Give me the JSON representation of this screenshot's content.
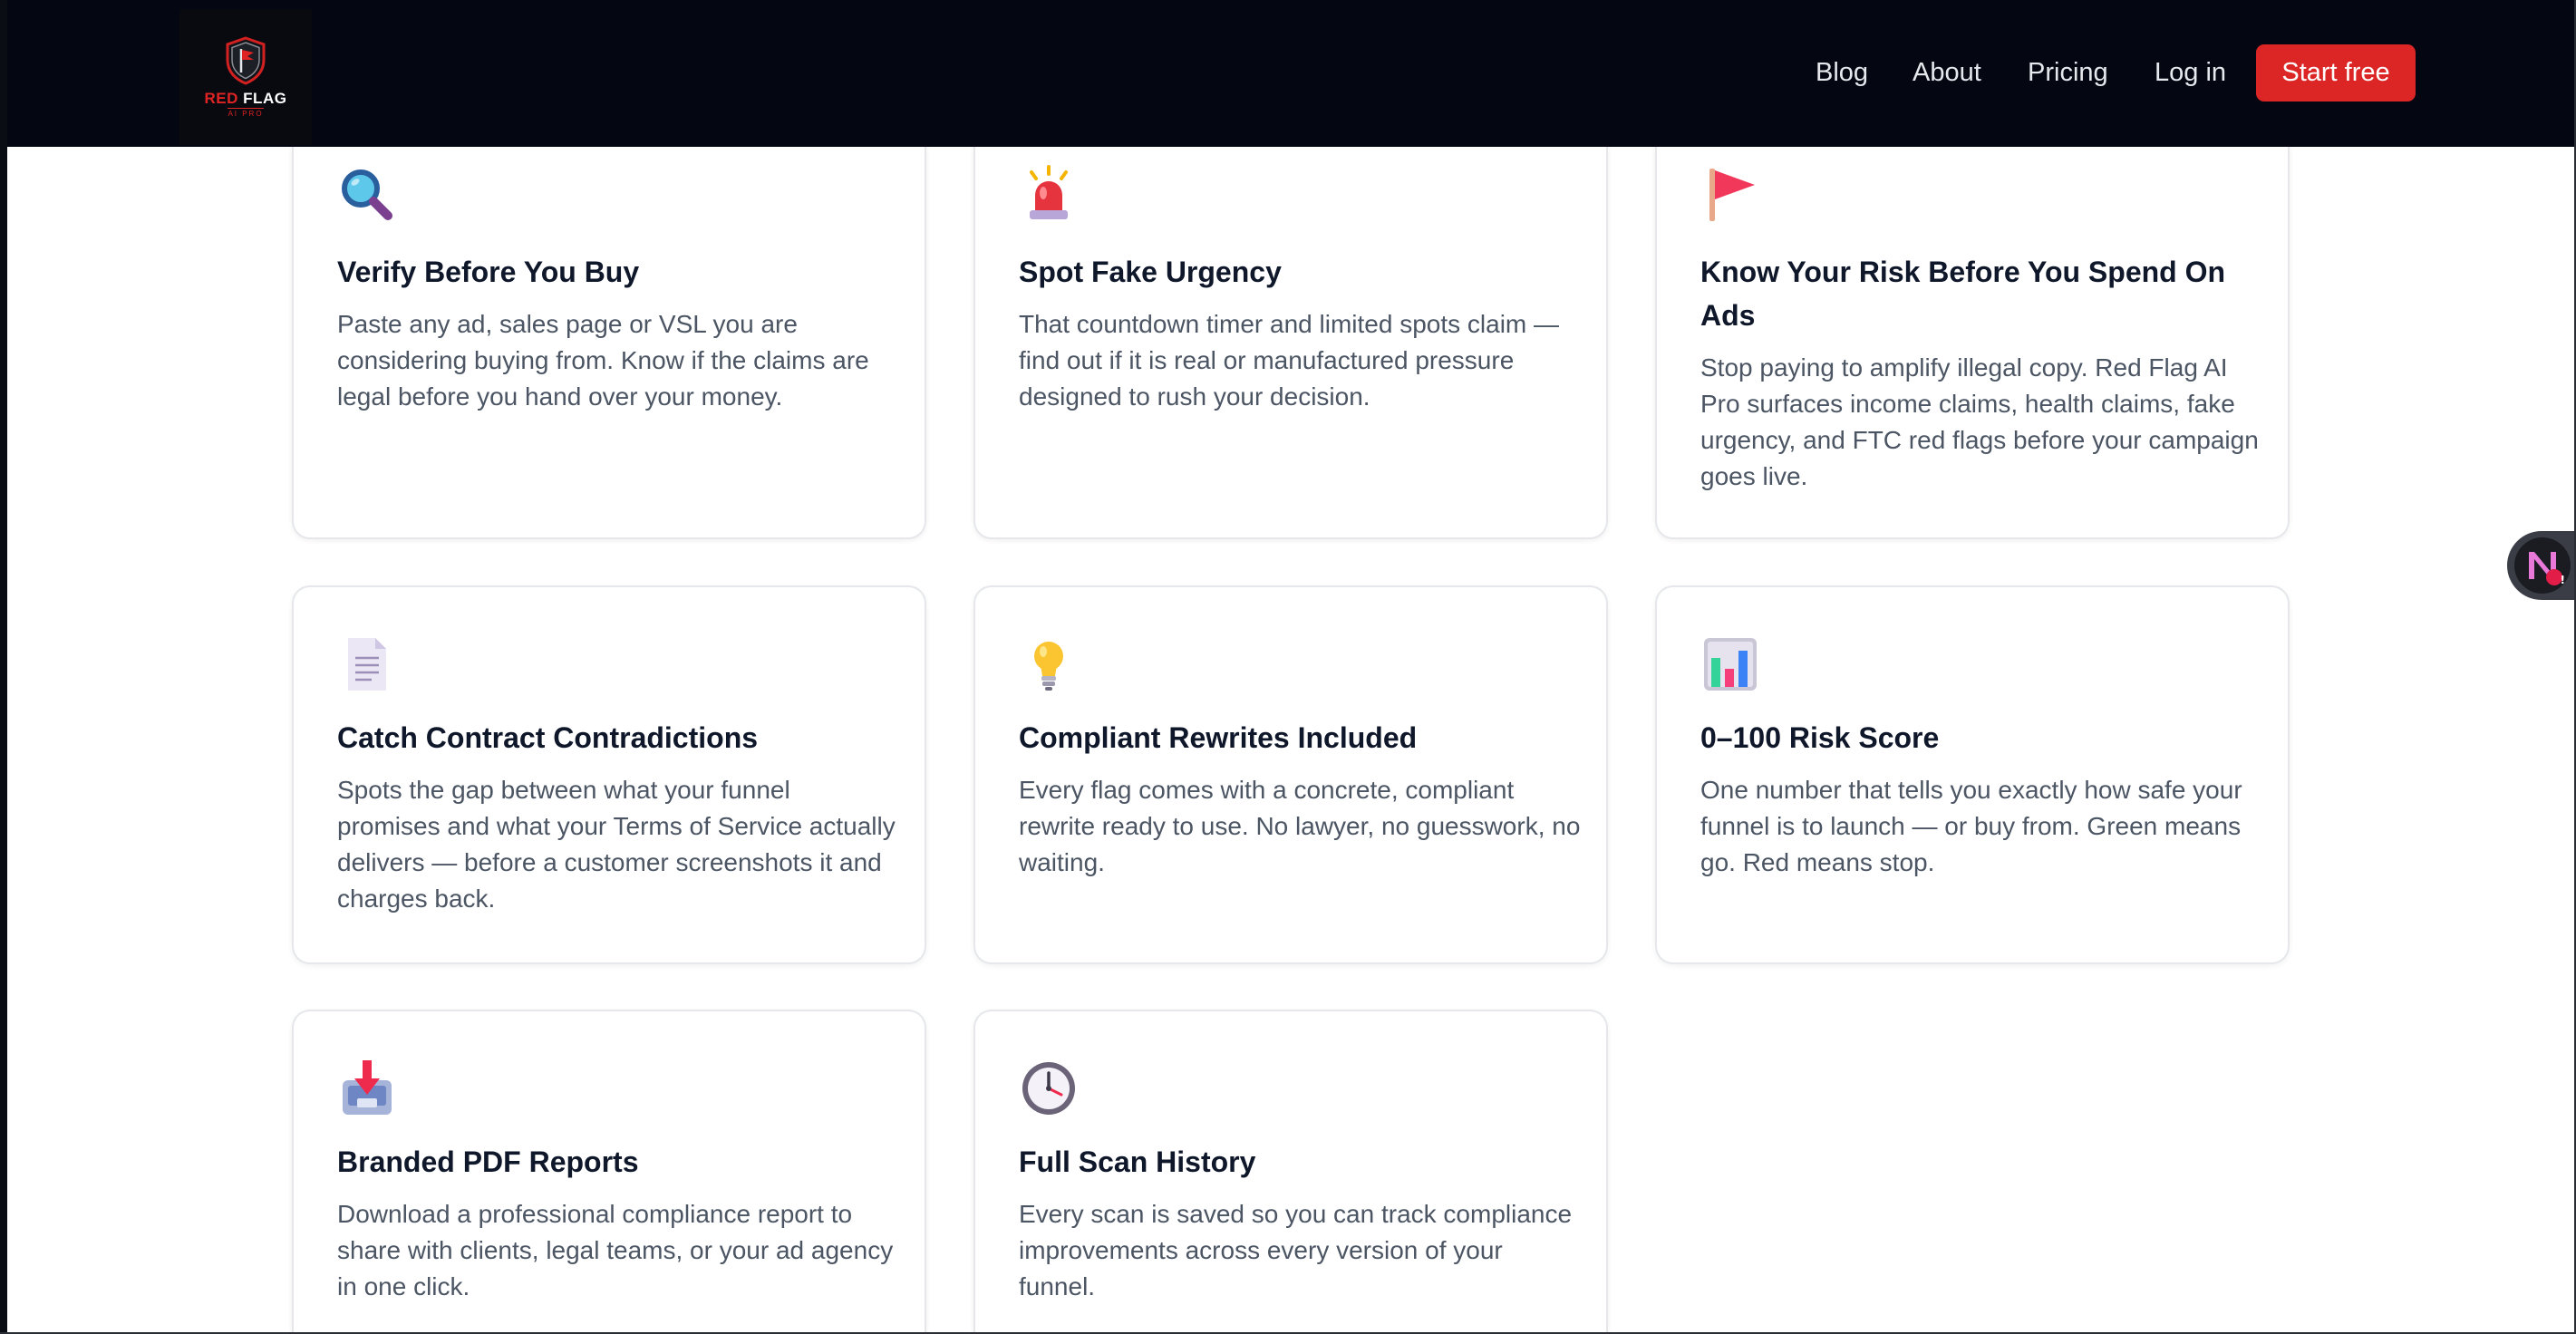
{
  "header": {
    "logo": {
      "line1_red": "RED",
      "line1_white": "FLAG",
      "line2": "AI PRO",
      "icon": "shield-flag-logo"
    },
    "nav": {
      "blog": "Blog",
      "about": "About",
      "pricing": "Pricing",
      "login": "Log in",
      "cta": "Start free"
    }
  },
  "features": [
    {
      "icon": "magnifying-glass-icon",
      "title": "Verify Before You Buy",
      "description": "Paste any ad, sales page or VSL you are considering buying from. Know if the claims are legal before you hand over your money."
    },
    {
      "icon": "siren-light-icon",
      "title": "Spot Fake Urgency",
      "description": "That countdown timer and limited spots claim — find out if it is real or manufactured pressure designed to rush your decision."
    },
    {
      "icon": "triangular-flag-icon",
      "title": "Know Your Risk Before You Spend On Ads",
      "description": "Stop paying to amplify illegal copy. Red Flag AI Pro surfaces income claims, health claims, fake urgency, and FTC red flags before your campaign goes live."
    },
    {
      "icon": "document-icon",
      "title": "Catch Contract Contradictions",
      "description": "Spots the gap between what your funnel promises and what your Terms of Service actually delivers — before a customer screenshots it and charges back."
    },
    {
      "icon": "light-bulb-icon",
      "title": "Compliant Rewrites Included",
      "description": "Every flag comes with a concrete, compliant rewrite ready to use. No lawyer, no guesswork, no waiting."
    },
    {
      "icon": "bar-chart-icon",
      "title": "0–100 Risk Score",
      "description": "One number that tells you exactly how safe your funnel is to launch — or buy from. Green means go. Red means stop."
    },
    {
      "icon": "inbox-download-icon",
      "title": "Branded PDF Reports",
      "description": "Download a professional compliance report to share with clients, legal teams, or your ad agency in one click."
    },
    {
      "icon": "clock-icon",
      "title": "Full Scan History",
      "description": "Every scan is saved so you can track compliance improvements across every version of your funnel."
    }
  ],
  "widget": {
    "icon": "extension-n-icon",
    "badge": "!"
  },
  "colors": {
    "header_bg": "#040711",
    "cta_bg": "#dc2626",
    "title": "#0f172a",
    "body_text": "#4b5563",
    "card_border": "#e5e7eb"
  }
}
